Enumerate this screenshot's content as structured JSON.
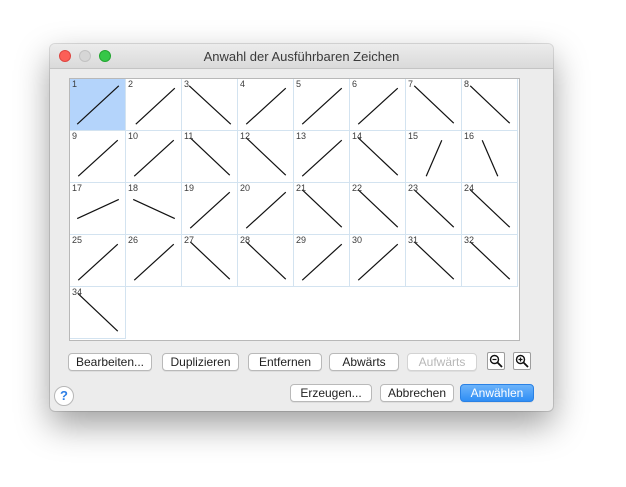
{
  "window": {
    "title": "Anwahl der Ausführbaren Zeichen"
  },
  "grid": {
    "selected": 1,
    "cells": [
      {
        "num": "1",
        "line": [
          0.1,
          0.9,
          0.9,
          0.1
        ]
      },
      {
        "num": "2",
        "line": [
          0.15,
          0.9,
          0.9,
          0.15
        ]
      },
      {
        "num": "3",
        "line": [
          0.1,
          0.1,
          0.9,
          0.9
        ]
      },
      {
        "num": "4",
        "line": [
          0.12,
          0.9,
          0.88,
          0.15
        ]
      },
      {
        "num": "5",
        "line": [
          0.12,
          0.9,
          0.88,
          0.15
        ]
      },
      {
        "num": "6",
        "line": [
          0.12,
          0.9,
          0.88,
          0.15
        ]
      },
      {
        "num": "7",
        "line": [
          0.12,
          0.1,
          0.88,
          0.88
        ]
      },
      {
        "num": "8",
        "line": [
          0.12,
          0.1,
          0.88,
          0.88
        ]
      },
      {
        "num": "9",
        "line": [
          0.12,
          0.9,
          0.88,
          0.15
        ]
      },
      {
        "num": "10",
        "line": [
          0.12,
          0.9,
          0.88,
          0.15
        ]
      },
      {
        "num": "11",
        "line": [
          0.12,
          0.1,
          0.88,
          0.88
        ]
      },
      {
        "num": "12",
        "line": [
          0.12,
          0.1,
          0.88,
          0.88
        ]
      },
      {
        "num": "13",
        "line": [
          0.12,
          0.9,
          0.88,
          0.15
        ]
      },
      {
        "num": "14",
        "line": [
          0.12,
          0.1,
          0.88,
          0.88
        ]
      },
      {
        "num": "15",
        "line": [
          0.35,
          0.9,
          0.65,
          0.15
        ]
      },
      {
        "num": "16",
        "line": [
          0.35,
          0.15,
          0.65,
          0.9
        ]
      },
      {
        "num": "17",
        "line": [
          0.1,
          0.7,
          0.9,
          0.3
        ]
      },
      {
        "num": "18",
        "line": [
          0.1,
          0.3,
          0.9,
          0.7
        ]
      },
      {
        "num": "19",
        "line": [
          0.12,
          0.9,
          0.88,
          0.15
        ]
      },
      {
        "num": "20",
        "line": [
          0.12,
          0.9,
          0.88,
          0.15
        ]
      },
      {
        "num": "21",
        "line": [
          0.12,
          0.1,
          0.88,
          0.88
        ]
      },
      {
        "num": "22",
        "line": [
          0.12,
          0.1,
          0.88,
          0.88
        ]
      },
      {
        "num": "23",
        "line": [
          0.12,
          0.1,
          0.88,
          0.88
        ]
      },
      {
        "num": "24",
        "line": [
          0.12,
          0.1,
          0.88,
          0.88
        ]
      },
      {
        "num": "25",
        "line": [
          0.12,
          0.9,
          0.88,
          0.15
        ]
      },
      {
        "num": "26",
        "line": [
          0.12,
          0.9,
          0.88,
          0.15
        ]
      },
      {
        "num": "27",
        "line": [
          0.12,
          0.1,
          0.88,
          0.88
        ]
      },
      {
        "num": "28",
        "line": [
          0.12,
          0.1,
          0.88,
          0.88
        ]
      },
      {
        "num": "29",
        "line": [
          0.12,
          0.9,
          0.88,
          0.15
        ]
      },
      {
        "num": "30",
        "line": [
          0.12,
          0.9,
          0.88,
          0.15
        ]
      },
      {
        "num": "31",
        "line": [
          0.12,
          0.1,
          0.88,
          0.88
        ]
      },
      {
        "num": "32",
        "line": [
          0.12,
          0.1,
          0.88,
          0.88
        ]
      },
      {
        "num": "34",
        "line": [
          0.12,
          0.1,
          0.88,
          0.88
        ]
      }
    ]
  },
  "toolbar": {
    "edit": "Bearbeiten...",
    "duplicate": "Duplizieren",
    "remove": "Entfernen",
    "down": "Abwärts",
    "up": "Aufwärts",
    "zoom_out_icon": "zoom-out-icon",
    "zoom_in_icon": "zoom-in-icon"
  },
  "footer": {
    "help": "?",
    "generate": "Erzeugen...",
    "cancel": "Abbrechen",
    "select": "Anwählen"
  },
  "colors": {
    "selection": "#b4d4fb",
    "primary_button": "#2f8ef5",
    "close": "#fc5f57",
    "maximize": "#35c748"
  }
}
